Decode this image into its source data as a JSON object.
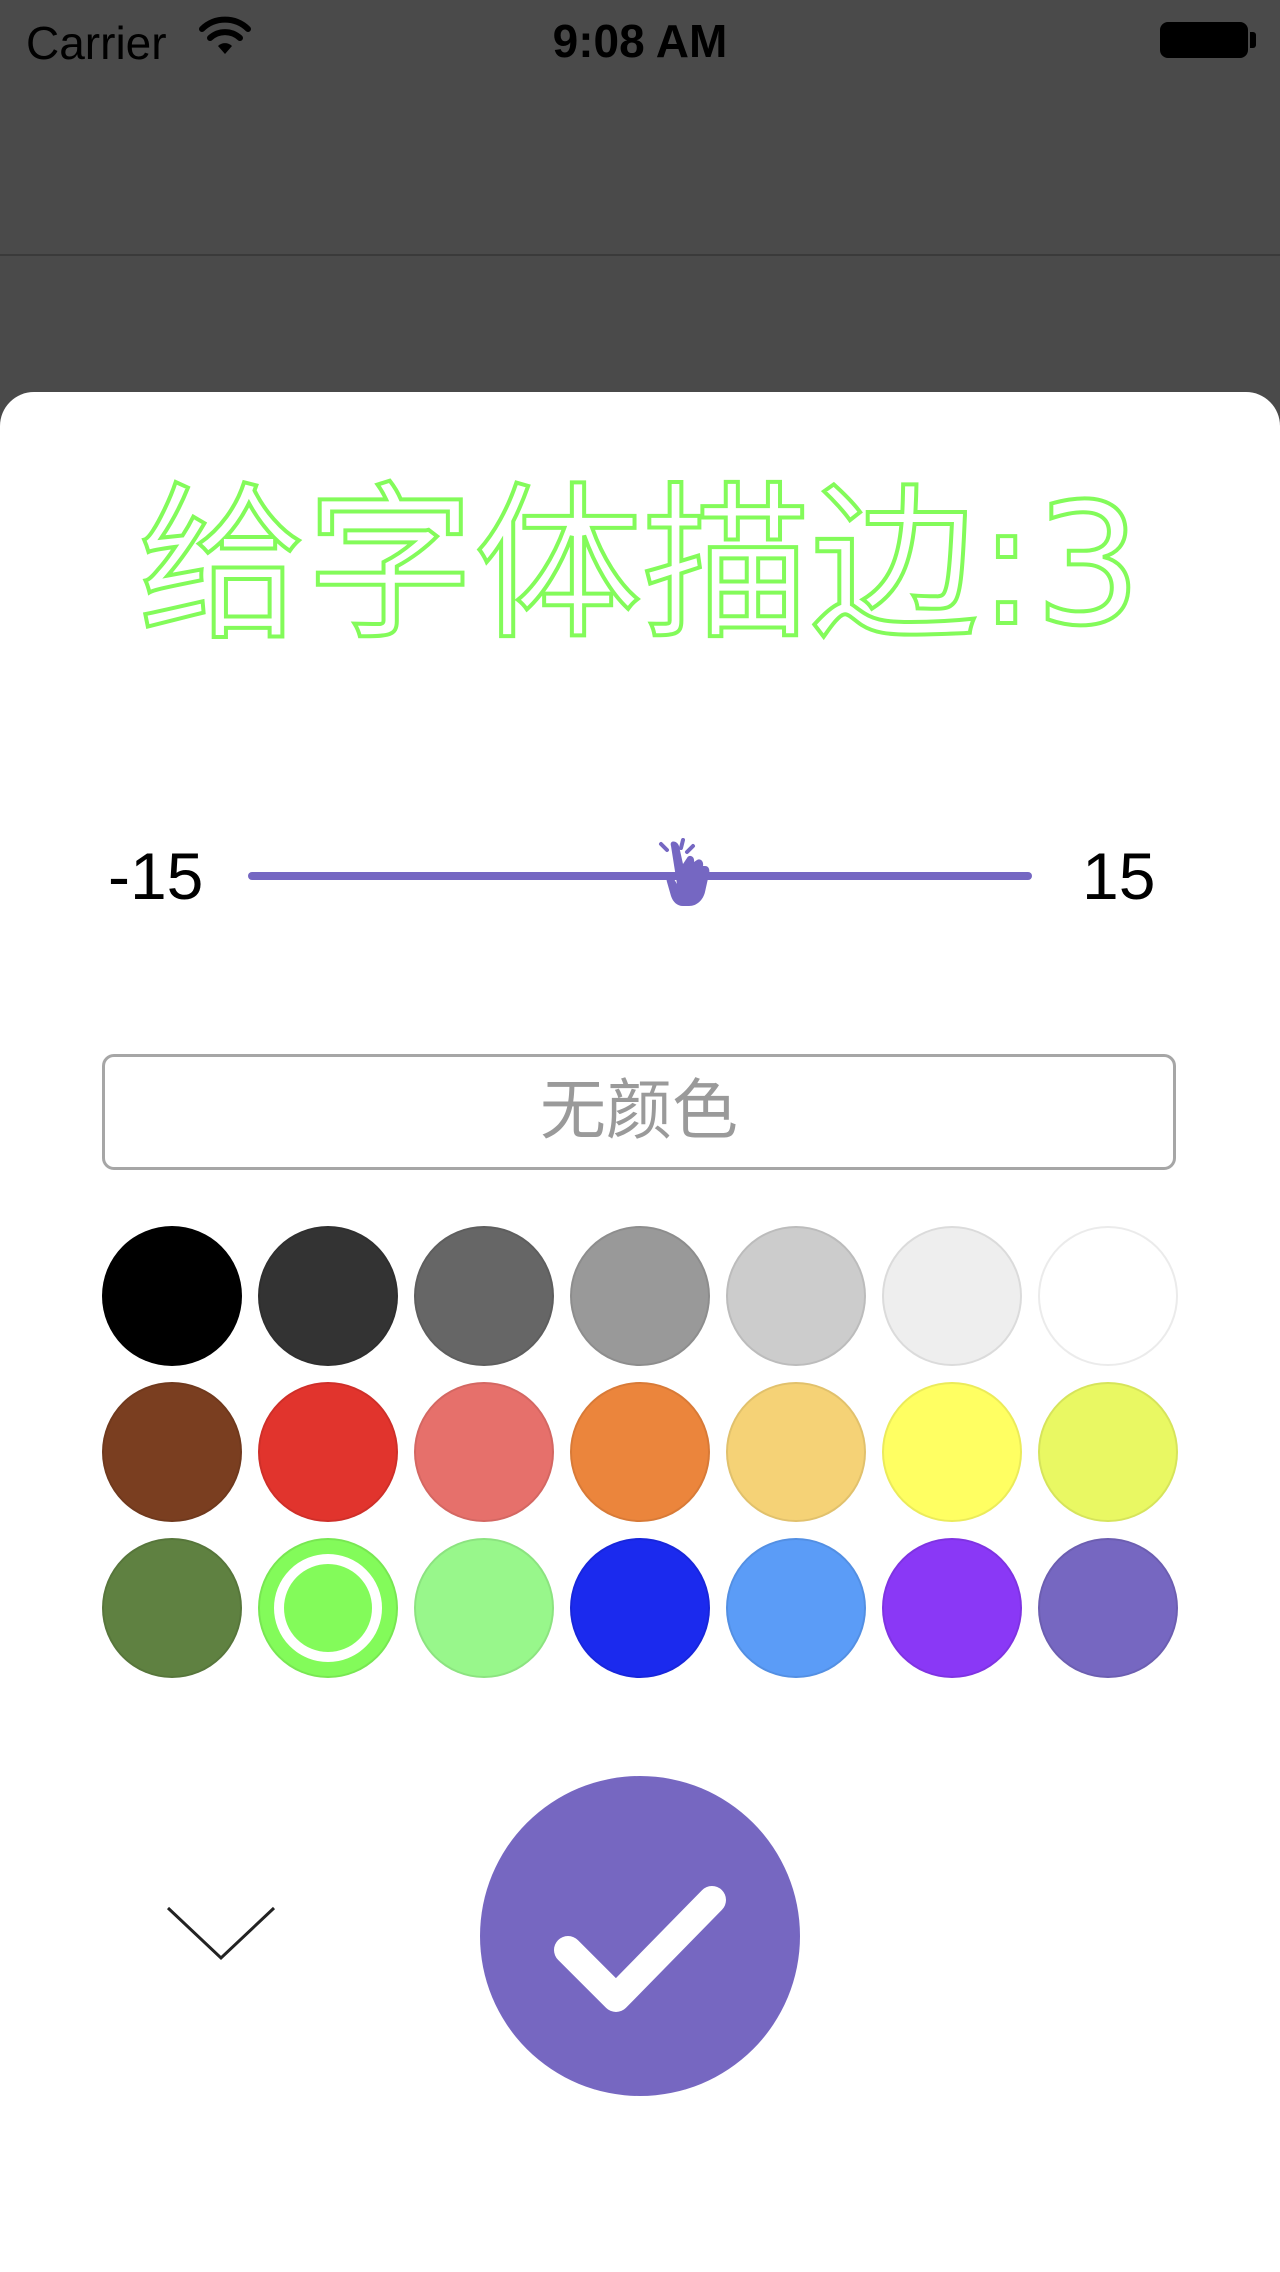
{
  "status_bar": {
    "carrier": "Carrier",
    "time": "9:08 AM",
    "wifi_icon": "wifi-icon",
    "battery_icon": "battery-full-icon"
  },
  "editor": {
    "title": "给字体描边:3",
    "stroke_color": "#83fb5a",
    "slider": {
      "min_label": "-15",
      "max_label": "15",
      "min": -15,
      "max": 15,
      "value": 3,
      "accent": "#7567c2",
      "thumb_icon": "hand-pointer-icon"
    },
    "no_color_label": "无颜色",
    "swatches": [
      {
        "color": "#000000",
        "selected": false
      },
      {
        "color": "#333333",
        "selected": false
      },
      {
        "color": "#666666",
        "selected": false
      },
      {
        "color": "#999999",
        "selected": false
      },
      {
        "color": "#cccccc",
        "selected": false
      },
      {
        "color": "#eeeeee",
        "selected": false
      },
      {
        "color": "#ffffff",
        "selected": false
      },
      {
        "color": "#7a3e20",
        "selected": false
      },
      {
        "color": "#e1342d",
        "selected": false
      },
      {
        "color": "#e6706b",
        "selected": false
      },
      {
        "color": "#eb853c",
        "selected": false
      },
      {
        "color": "#f5d276",
        "selected": false
      },
      {
        "color": "#ffff62",
        "selected": false
      },
      {
        "color": "#e9f863",
        "selected": false
      },
      {
        "color": "#5f8141",
        "selected": false
      },
      {
        "color": "#83fb5a",
        "selected": true
      },
      {
        "color": "#98f78b",
        "selected": false
      },
      {
        "color": "#1b2aee",
        "selected": false
      },
      {
        "color": "#5b9cf7",
        "selected": false
      },
      {
        "color": "#8a38f6",
        "selected": false
      },
      {
        "color": "#7667c1",
        "selected": false
      }
    ],
    "collapse_icon": "chevron-down-icon",
    "confirm_icon": "checkmark-icon",
    "confirm_color": "#7667c1"
  }
}
